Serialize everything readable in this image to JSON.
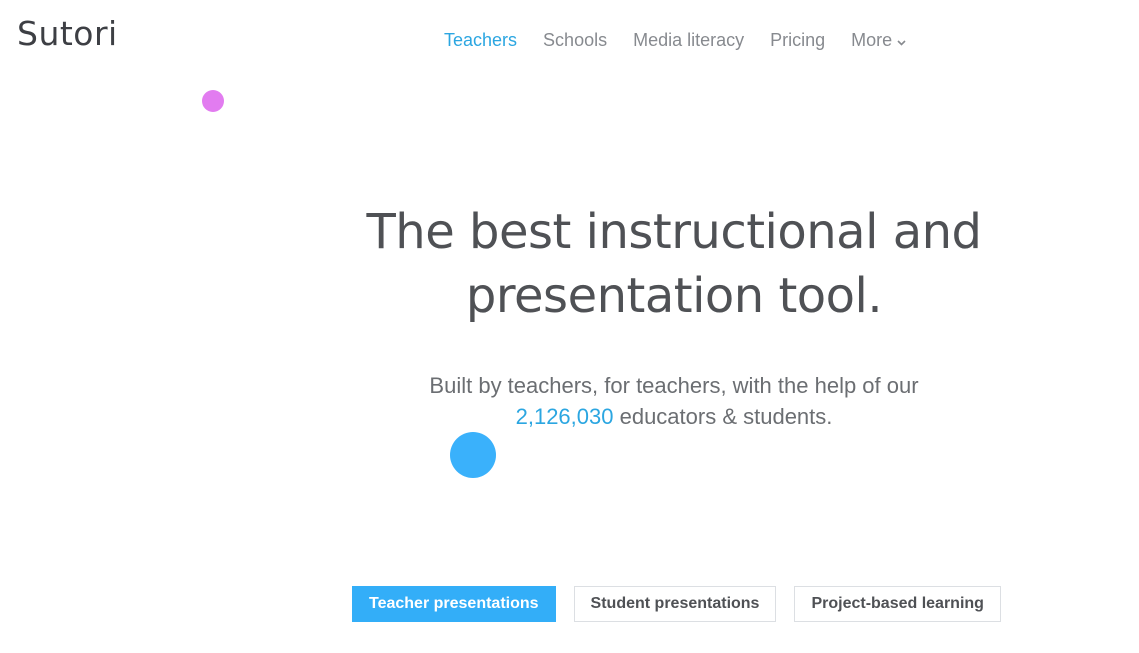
{
  "brand": {
    "logo": "Sutori"
  },
  "nav": {
    "items": [
      {
        "label": "Teachers",
        "active": true
      },
      {
        "label": "Schools",
        "active": false
      },
      {
        "label": "Media literacy",
        "active": false
      },
      {
        "label": "Pricing",
        "active": false
      }
    ],
    "more_label": "More",
    "more_icon": "chevron-down-icon"
  },
  "hero": {
    "title_line1": "The best instructional and",
    "title_line2": "presentation tool.",
    "subtitle_line1": "Built by teachers, for teachers, with the help of our",
    "count": "2,126,030",
    "subtitle_line2_rest": " educators & students."
  },
  "tabs": [
    {
      "label": "Teacher presentations",
      "active": true
    },
    {
      "label": "Student presentations",
      "active": false
    },
    {
      "label": "Project-based learning",
      "active": false
    }
  ],
  "colors": {
    "accent": "#2ba6e1",
    "pink_dot": "#e27cf0",
    "blue_dot": "#3ab1fb",
    "active_tab": "#33aef8",
    "heading": "#4f5155"
  }
}
